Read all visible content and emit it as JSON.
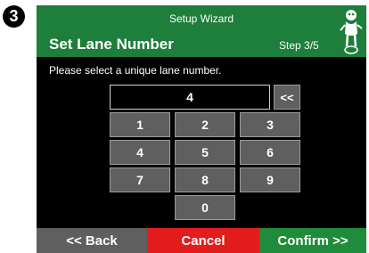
{
  "step_marker": "3",
  "header": {
    "wizard_title": "Setup Wizard",
    "screen_title": "Set Lane Number",
    "step": "Step 3/5",
    "logo_icon": "mascot-logo-icon"
  },
  "prompt": "Please select a unique lane number.",
  "display_value": "4",
  "backspace_label": "<<",
  "keypad": {
    "k1": "1",
    "k2": "2",
    "k3": "3",
    "k4": "4",
    "k5": "5",
    "k6": "6",
    "k7": "7",
    "k8": "8",
    "k9": "9",
    "k0": "0"
  },
  "footer": {
    "back": "<< Back",
    "cancel": "Cancel",
    "confirm": "Confirm >>"
  },
  "colors": {
    "title_bar": "#1e7e3b",
    "key": "#5f5f5f",
    "cancel": "#e31c1c",
    "confirm": "#1e8c3b"
  }
}
